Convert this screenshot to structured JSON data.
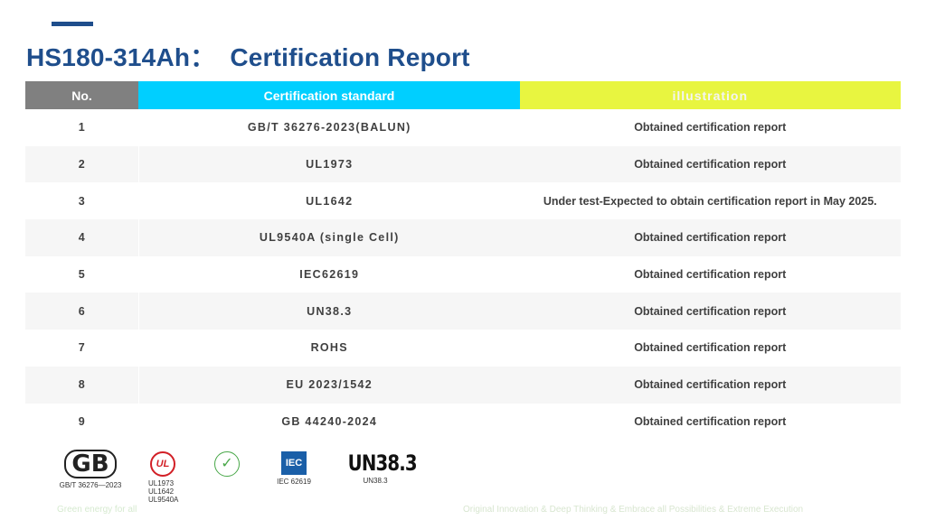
{
  "page": {
    "title": "HS180-314Ah：  Certification Report"
  },
  "table": {
    "headers": [
      "No.",
      "Certification standard",
      "illustration"
    ],
    "rows": [
      {
        "no": "1",
        "standard": "GB/T 36276-2023(BALUN)",
        "illustration": "Obtained certification report"
      },
      {
        "no": "2",
        "standard": "UL1973",
        "illustration": "Obtained certification report"
      },
      {
        "no": "3",
        "standard": "UL1642",
        "illustration": "Under test-Expected to obtain certification report in May 2025."
      },
      {
        "no": "4",
        "standard": "UL9540A (single Cell)",
        "illustration": "Obtained certification report"
      },
      {
        "no": "5",
        "standard": "IEC62619",
        "illustration": "Obtained certification report"
      },
      {
        "no": "6",
        "standard": "UN38.3",
        "illustration": "Obtained certification report"
      },
      {
        "no": "7",
        "standard": "ROHS",
        "illustration": "Obtained certification report"
      },
      {
        "no": "8",
        "standard": "EU 2023/1542",
        "illustration": "Obtained certification report"
      },
      {
        "no": "9",
        "standard": "GB 44240-2024",
        "illustration": "Obtained certification report"
      }
    ]
  },
  "logos": {
    "gb_mark": "GB",
    "gb_caption": "GB/T 36276—2023",
    "ul_mark": "UL",
    "ul_caption": [
      "UL1973",
      "UL1642",
      "UL9540A"
    ],
    "rohs_mark": "✓",
    "iec_mark": "IEC",
    "iec_caption": "IEC 62619",
    "un_mark": "UN38.3",
    "un_caption": "UN38.3"
  },
  "footer": {
    "left": "Green energy for all",
    "right": "Original Innovation & Deep Thinking & Embrace all Possibilities & Extreme Execution"
  },
  "colors": {
    "title": "#1f4e8c",
    "header_no": "#808080",
    "header_standard": "#00cfff",
    "header_illustration": "#e8f540"
  }
}
